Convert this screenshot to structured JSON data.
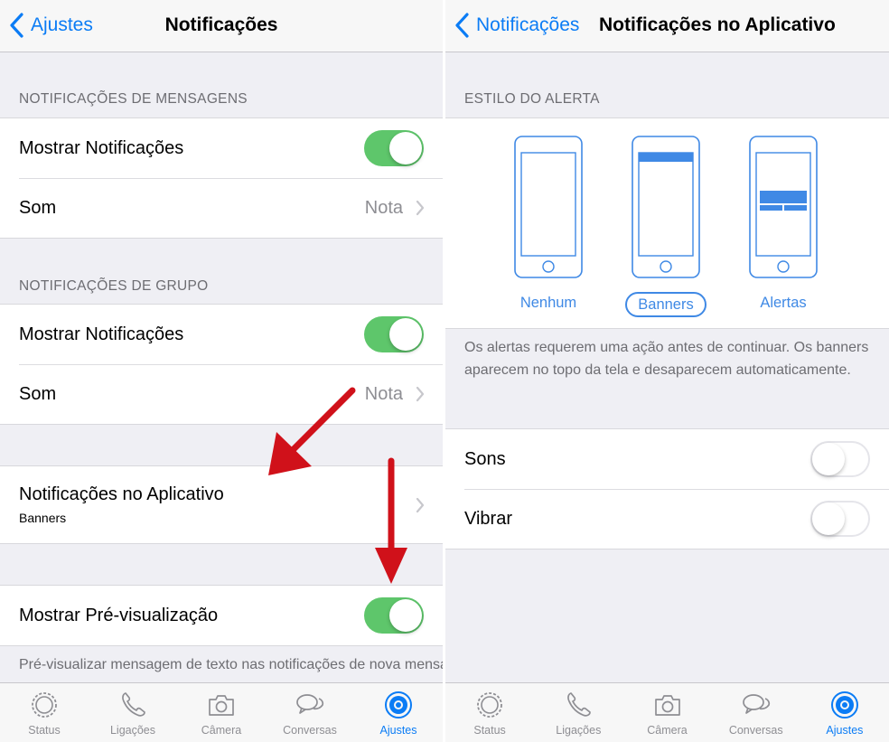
{
  "left": {
    "nav": {
      "back_label": "Ajustes",
      "title": "Notificações"
    },
    "sections": {
      "messages": {
        "header": "NOTIFICAÇÕES DE MENSAGENS",
        "show_label": "Mostrar Notificações",
        "show_on": true,
        "sound_label": "Som",
        "sound_value": "Nota"
      },
      "group": {
        "header": "NOTIFICAÇÕES DE GRUPO",
        "show_label": "Mostrar Notificações",
        "show_on": true,
        "sound_label": "Som",
        "sound_value": "Nota"
      },
      "in_app": {
        "label": "Notificações no Aplicativo",
        "sublabel": "Banners"
      },
      "preview": {
        "label": "Mostrar Pré-visualização",
        "on": true,
        "footer": "Pré-visualizar mensagem de texto nas notificações de nova mensagem."
      }
    }
  },
  "right": {
    "nav": {
      "back_label": "Notificações",
      "title": "Notificações no Aplicativo"
    },
    "alert_style": {
      "header": "ESTILO DO ALERTA",
      "options": [
        {
          "label": "Nenhum",
          "selected": false
        },
        {
          "label": "Banners",
          "selected": true
        },
        {
          "label": "Alertas",
          "selected": false
        }
      ],
      "footer": "Os alertas requerem uma ação antes de continuar. Os banners aparecem no topo da tela e desaparecem automaticamente."
    },
    "sounds_label": "Sons",
    "sounds_on": false,
    "vibrate_label": "Vibrar",
    "vibrate_on": false
  },
  "tabbar": {
    "tabs": [
      {
        "label": "Status",
        "icon": "status-icon"
      },
      {
        "label": "Ligações",
        "icon": "phone-icon"
      },
      {
        "label": "Câmera",
        "icon": "camera-icon"
      },
      {
        "label": "Conversas",
        "icon": "chat-icon"
      },
      {
        "label": "Ajustes",
        "icon": "settings-gear-icon"
      }
    ],
    "active": "Ajustes"
  },
  "colors": {
    "accent": "#0b7cf5",
    "toggle_on": "#5ec66b",
    "annotation_arrow": "#d0111a"
  }
}
